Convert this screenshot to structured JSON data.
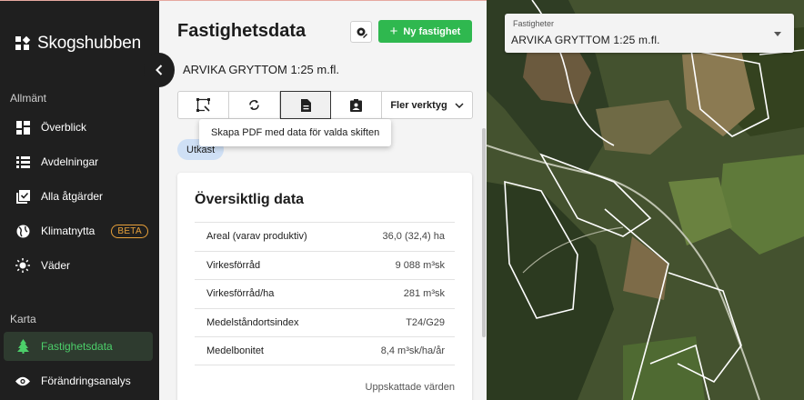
{
  "app": {
    "brand": "Skogshubben"
  },
  "sidebar": {
    "section_general": "Allmänt",
    "section_map": "Karta",
    "items": [
      {
        "label": "Överblick"
      },
      {
        "label": "Avdelningar"
      },
      {
        "label": "Alla åtgärder"
      },
      {
        "label": "Klimatnytta",
        "badge": "BETA"
      },
      {
        "label": "Väder"
      },
      {
        "label": "Fastighetsdata",
        "active": true
      },
      {
        "label": "Förändringsanalys"
      }
    ]
  },
  "panel": {
    "title": "Fastighetsdata",
    "new_property_label": "Ny fastighet",
    "property_name": "ARVIKA GRYTTOM 1:25 m.fl.",
    "more_tools_label": "Fler verktyg",
    "tooltip": "Skapa PDF med data för valda skiften",
    "status_chip": "Utkast"
  },
  "overview": {
    "title": "Översiktlig data",
    "rows": [
      {
        "label": "Areal (varav produktiv)",
        "value": "36,0 (32,4) ha"
      },
      {
        "label": "Virkesförråd",
        "value": "9 088 m³sk"
      },
      {
        "label": "Virkesförråd/ha",
        "value": "281 m³sk"
      },
      {
        "label": "Medelståndortsindex",
        "value": "T24/G29"
      },
      {
        "label": "Medelbonitet",
        "value": "8,4 m³sk/ha/år"
      }
    ],
    "footnote": "Uppskattade värden"
  },
  "map": {
    "select_label": "Fastigheter",
    "select_value": "ARVIKA GRYTTOM 1:25 m.fl."
  },
  "colors": {
    "sidebar_bg": "#1f1f1f",
    "accent_green": "#2fb84f",
    "active_text": "#4ccf6a",
    "beta_orange": "#e8a13a",
    "chip_blue": "#cfe0f5"
  }
}
